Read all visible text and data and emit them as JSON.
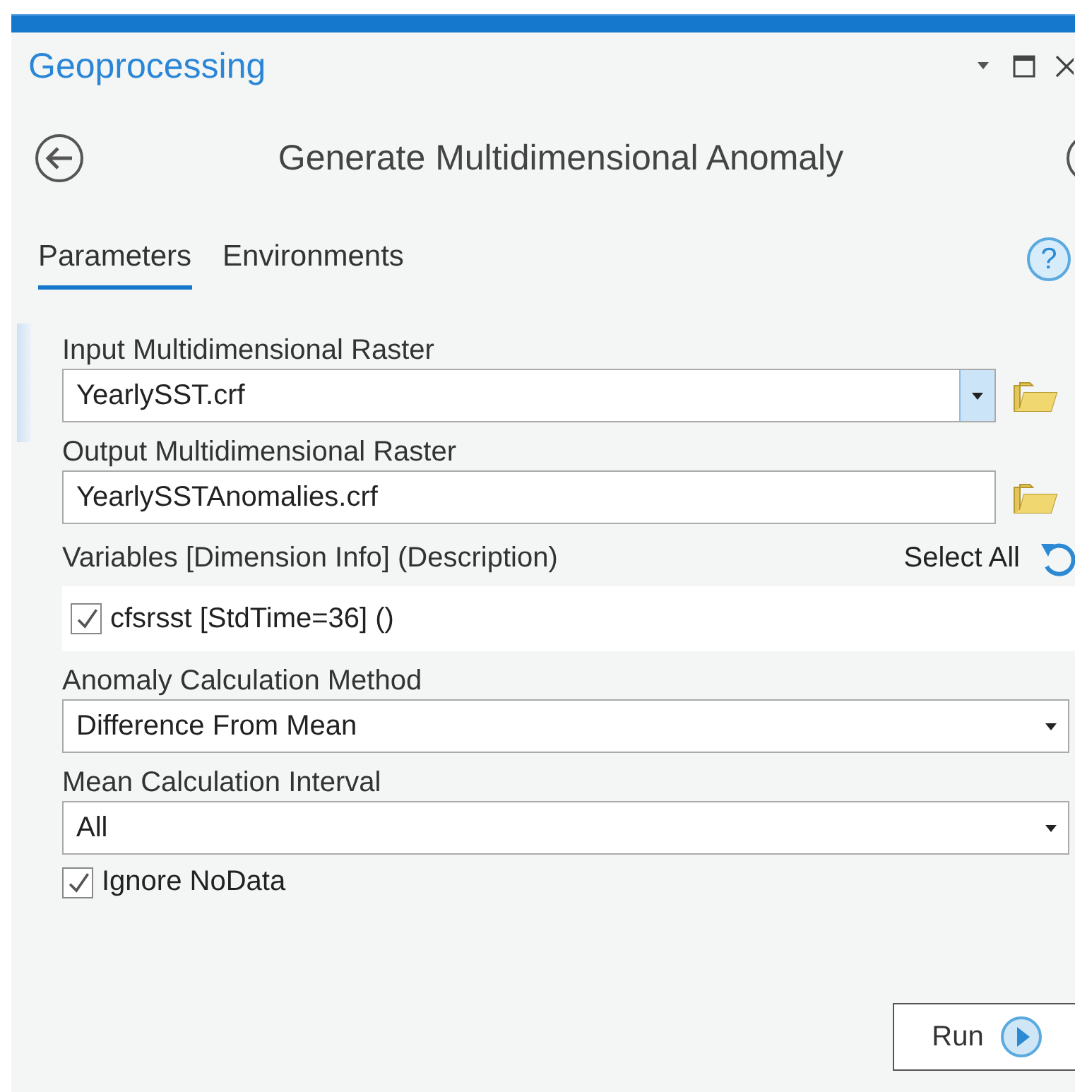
{
  "panel": {
    "title": "Geoprocessing"
  },
  "tool": {
    "title": "Generate Multidimensional Anomaly"
  },
  "tabs": [
    {
      "label": "Parameters",
      "selected": true
    },
    {
      "label": "Environments",
      "selected": false
    }
  ],
  "help_button": {
    "label": "?"
  },
  "parameters": [
    {
      "kind": "combo_browse",
      "label": "Input Multidimensional Raster",
      "value": "YearlySST.crf",
      "focused": true
    },
    {
      "kind": "browse",
      "label": "Output Multidimensional Raster",
      "value": "YearlySSTAnomalies.crf",
      "focused": false
    },
    {
      "kind": "checklist",
      "label": "Variables [Dimension Info] (Description)",
      "action": "Select All",
      "items": [
        {
          "label": "cfsrsst [StdTime=36] ()",
          "checked": true
        }
      ]
    },
    {
      "kind": "dropdown",
      "label": "Anomaly Calculation Method",
      "value": "Difference From Mean"
    },
    {
      "kind": "dropdown",
      "label": "Mean Calculation Interval",
      "value": "All"
    },
    {
      "kind": "checkbox",
      "label": "Ignore NoData",
      "checked": true
    }
  ],
  "run_button": {
    "label": "Run"
  }
}
